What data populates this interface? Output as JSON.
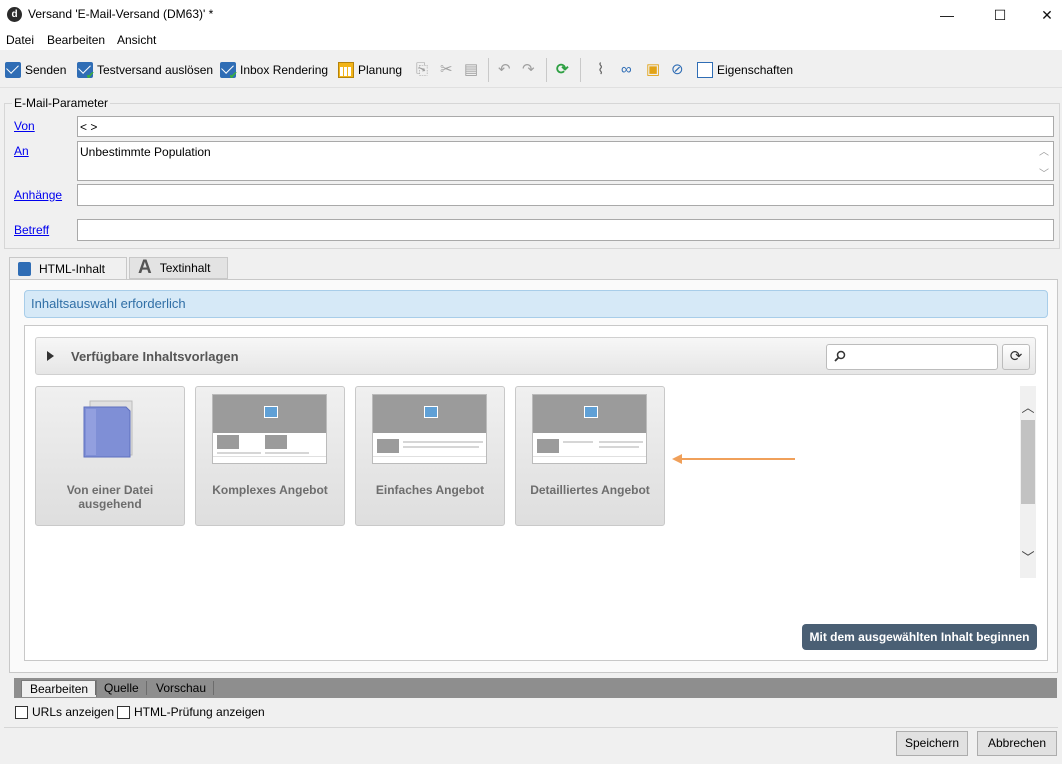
{
  "window": {
    "title": "Versand 'E-Mail-Versand (DM63)' *",
    "icon_name": "app-logo-icon",
    "controls": {
      "minimize": "—",
      "maximize": "☐",
      "close": "✕"
    }
  },
  "menu": [
    "Datei",
    "Bearbeiten",
    "Ansicht"
  ],
  "toolbar": {
    "send": "Senden",
    "test_send": "Testversand auslösen",
    "inbox_rendering": "Inbox Rendering",
    "planning": "Planung",
    "properties": "Eigenschaften"
  },
  "params": {
    "legend": "E-Mail-Parameter",
    "from_label": "Von",
    "from_value": "< >",
    "to_label": "An",
    "to_value": "Unbestimmte Population",
    "attachments_label": "Anhänge",
    "attachments_value": "",
    "subject_label": "Betreff",
    "subject_value": ""
  },
  "tabs": {
    "html": "HTML-Inhalt",
    "text": "Textinhalt",
    "text_glyph": "A"
  },
  "info_bar": "Inhaltsauswahl erforderlich",
  "templates": {
    "header": "Verfügbare Inhaltsvorlagen",
    "search_placeholder": "",
    "cards": [
      {
        "label": "Von einer Datei ausgehend",
        "icon": "folder-icon"
      },
      {
        "label": "Komplexes Angebot",
        "icon": "template-thumbnail"
      },
      {
        "label": "Einfaches Angebot",
        "icon": "template-thumbnail"
      },
      {
        "label": "Detailliertes Angebot",
        "icon": "template-thumbnail"
      }
    ],
    "start_button": "Mit dem ausgewählten Inhalt beginnen"
  },
  "bottom_tabs": [
    "Bearbeiten",
    "Quelle",
    "Vorschau"
  ],
  "checkboxes": {
    "urls": {
      "label": "URLs anzeigen",
      "checked": false
    },
    "html_check": {
      "label": "HTML-Prüfung anzeigen",
      "checked": false
    }
  },
  "buttons": {
    "save": "Speichern",
    "cancel": "Abbrechen"
  },
  "colors": {
    "info_bg": "#d6e9f7",
    "info_text": "#306fa6",
    "primary_button": "#4a5f74",
    "annotation_arrow": "#f0a05a"
  }
}
